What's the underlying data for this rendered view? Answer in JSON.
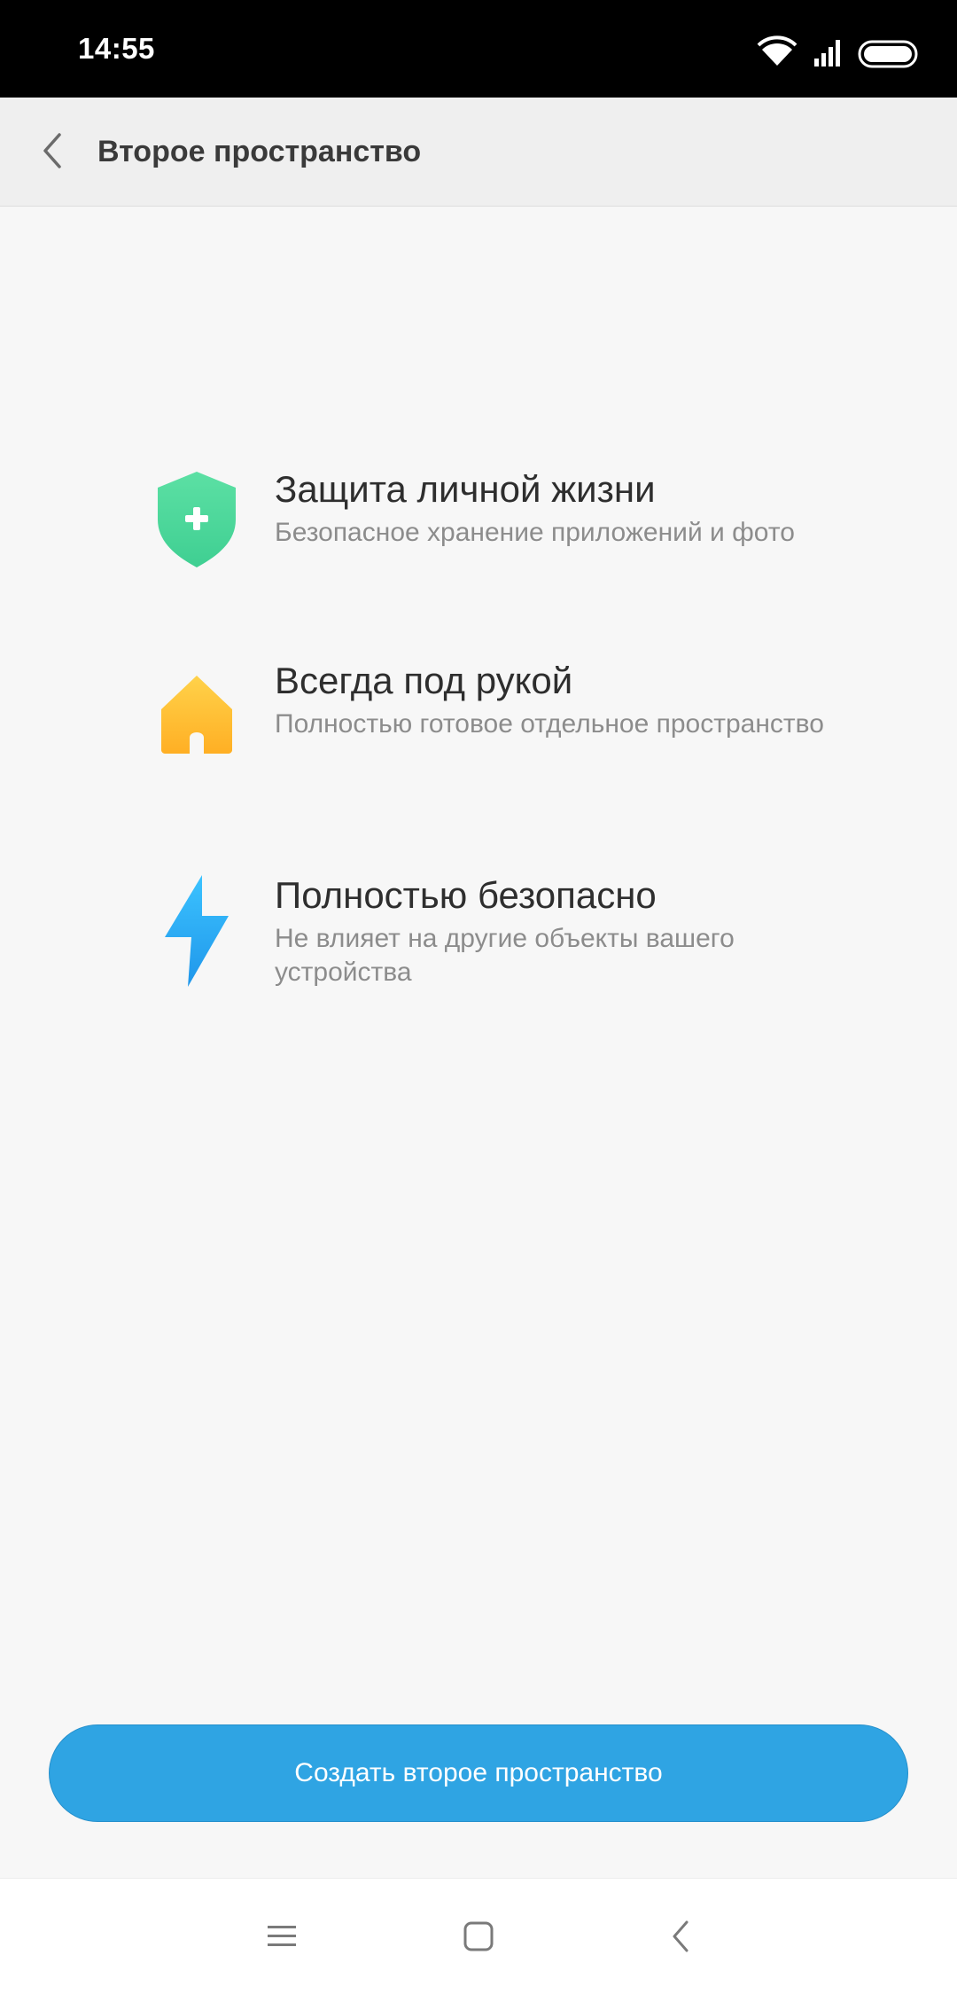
{
  "status_bar": {
    "time": "14:55",
    "icons": [
      "wifi-icon",
      "signal-icon",
      "battery-icon"
    ]
  },
  "header": {
    "title": "Второе пространство",
    "back_icon": "chevron-left-icon"
  },
  "features": [
    {
      "icon": "shield-plus-icon",
      "title": "Защита личной жизни",
      "description": "Безопасное хранение приложений и фото"
    },
    {
      "icon": "house-icon",
      "title": "Всегда под рукой",
      "description": "Полностью готовое отдельное пространство"
    },
    {
      "icon": "lightning-icon",
      "title": "Полностью безопасно",
      "description": "Не влияет на другие объекты вашего устройства"
    }
  ],
  "create_button": {
    "label": "Создать второе пространство"
  },
  "nav_bar": {
    "items": [
      "menu-icon",
      "home-square-icon",
      "back-icon"
    ]
  },
  "colors": {
    "accent": "#2fa4e3",
    "shield": "#4fd69c",
    "house": "#ffbe2e",
    "lightning": "#2aa9f2"
  }
}
